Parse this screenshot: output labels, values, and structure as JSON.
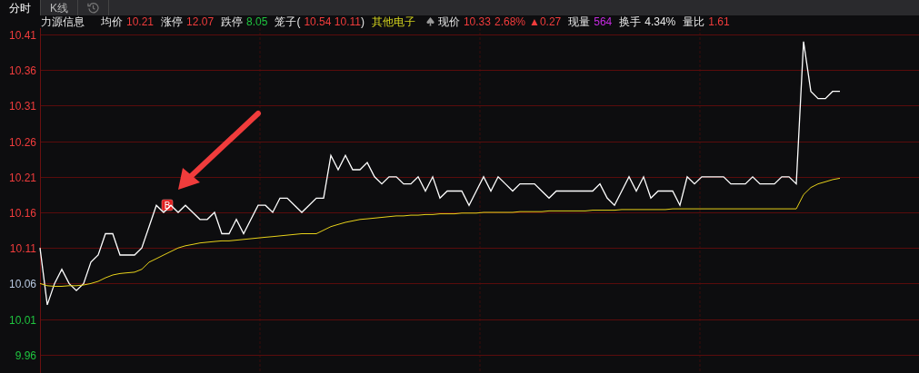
{
  "tabs": [
    {
      "kind": "text",
      "label": "分时",
      "selected": true
    },
    {
      "kind": "text",
      "label": "K线",
      "selected": false
    },
    {
      "kind": "history",
      "selected": false
    }
  ],
  "quote": [
    {
      "kind": "name",
      "text": "力源信息"
    },
    {
      "kind": "field",
      "label": "均价",
      "values": [
        {
          "text": "10.21",
          "color": "#f03c3c"
        }
      ]
    },
    {
      "kind": "field",
      "label": "涨停",
      "values": [
        {
          "text": "12.07",
          "color": "#f03c3c"
        }
      ]
    },
    {
      "kind": "field",
      "label": "跌停",
      "values": [
        {
          "text": "8.05",
          "color": "#1fc43f"
        }
      ]
    },
    {
      "kind": "field",
      "label": "笼子(",
      "values": [
        {
          "text": "10.54 10.11",
          "color": "#f03c3c"
        }
      ],
      "suffix": ")"
    },
    {
      "kind": "sector",
      "text": "其他电子"
    },
    {
      "kind": "price",
      "label": "现价",
      "values": [
        {
          "text": "10.33",
          "color": "#f03c3c"
        },
        {
          "text": "2.68%",
          "color": "#f03c3c"
        },
        {
          "text": "▲0.27",
          "color": "#f03c3c"
        }
      ]
    },
    {
      "kind": "field",
      "label": "现量",
      "values": [
        {
          "text": "564",
          "color": "#c42ae0"
        }
      ]
    },
    {
      "kind": "field",
      "label": "换手",
      "values": [
        {
          "text": "4.34%",
          "color": "#e8e8e8"
        }
      ]
    },
    {
      "kind": "field",
      "label": "量比",
      "values": [
        {
          "text": "1.61",
          "color": "#f03c3c"
        }
      ]
    }
  ],
  "chart_data": {
    "type": "line",
    "ylim": [
      9.96,
      10.41
    ],
    "grid": true,
    "yticks": [
      {
        "value": 10.41,
        "label": "10.41"
      },
      {
        "value": 10.36,
        "label": "10.36"
      },
      {
        "value": 10.31,
        "label": "10.31"
      },
      {
        "value": 10.26,
        "label": "10.26"
      },
      {
        "value": 10.21,
        "label": "10.21"
      },
      {
        "value": 10.16,
        "label": "10.16"
      },
      {
        "value": 10.11,
        "label": "10.11"
      },
      {
        "value": 10.06,
        "label": "10.06"
      },
      {
        "value": 10.01,
        "label": "10.01"
      },
      {
        "value": 9.96,
        "label": "9.96"
      }
    ],
    "series": [
      {
        "color": "#ffffff",
        "values": [
          10.11,
          10.03,
          10.06,
          10.08,
          10.06,
          10.05,
          10.06,
          10.09,
          10.1,
          10.13,
          10.13,
          10.1,
          10.1,
          10.1,
          10.11,
          10.14,
          10.17,
          10.16,
          10.17,
          10.16,
          10.17,
          10.16,
          10.15,
          10.15,
          10.16,
          10.13,
          10.13,
          10.15,
          10.13,
          10.15,
          10.17,
          10.17,
          10.16,
          10.18,
          10.18,
          10.17,
          10.16,
          10.17,
          10.18,
          10.18,
          10.24,
          10.22,
          10.24,
          10.22,
          10.22,
          10.23,
          10.21,
          10.2,
          10.21,
          10.21,
          10.2,
          10.2,
          10.21,
          10.19,
          10.21,
          10.18,
          10.19,
          10.19,
          10.19,
          10.17,
          10.19,
          10.21,
          10.19,
          10.21,
          10.2,
          10.19,
          10.2,
          10.2,
          10.2,
          10.19,
          10.18,
          10.19,
          10.19,
          10.19,
          10.19,
          10.19,
          10.19,
          10.2,
          10.18,
          10.17,
          10.19,
          10.21,
          10.19,
          10.21,
          10.18,
          10.19,
          10.19,
          10.19,
          10.17,
          10.21,
          10.2,
          10.21,
          10.21,
          10.21,
          10.21,
          10.2,
          10.2,
          10.2,
          10.21,
          10.2,
          10.2,
          10.2,
          10.21,
          10.21,
          10.2,
          10.4,
          10.33,
          10.32,
          10.32,
          10.33,
          10.33
        ]
      },
      {
        "color": "#e8d21a",
        "values": [
          10.06,
          10.057,
          10.056,
          10.056,
          10.057,
          10.057,
          10.058,
          10.06,
          10.063,
          10.068,
          10.072,
          10.074,
          10.075,
          10.076,
          10.08,
          10.09,
          10.095,
          10.1,
          10.105,
          10.11,
          10.113,
          10.115,
          10.117,
          10.118,
          10.119,
          10.12,
          10.12,
          10.121,
          10.122,
          10.123,
          10.124,
          10.125,
          10.126,
          10.127,
          10.128,
          10.129,
          10.13,
          10.13,
          10.13,
          10.135,
          10.14,
          10.143,
          10.146,
          10.148,
          10.15,
          10.151,
          10.152,
          10.153,
          10.154,
          10.155,
          10.155,
          10.156,
          10.156,
          10.157,
          10.157,
          10.158,
          10.158,
          10.158,
          10.159,
          10.159,
          10.159,
          10.16,
          10.16,
          10.16,
          10.16,
          10.16,
          10.161,
          10.161,
          10.161,
          10.161,
          10.162,
          10.162,
          10.162,
          10.162,
          10.162,
          10.162,
          10.163,
          10.163,
          10.163,
          10.163,
          10.164,
          10.164,
          10.164,
          10.164,
          10.164,
          10.164,
          10.164,
          10.165,
          10.165,
          10.165,
          10.165,
          10.165,
          10.165,
          10.165,
          10.165,
          10.165,
          10.165,
          10.165,
          10.165,
          10.165,
          10.165,
          10.165,
          10.165,
          10.165,
          10.165,
          10.185,
          10.195,
          10.2,
          10.203,
          10.206,
          10.208
        ]
      }
    ],
    "annotations": [
      {
        "text": "B",
        "y": 10.16
      }
    ]
  },
  "axis_labels": [
    {
      "color": "#f03c3c"
    },
    {
      "color": "#f03c3c"
    },
    {
      "color": "#f03c3c"
    },
    {
      "color": "#f03c3c"
    },
    {
      "color": "#f03c3c"
    },
    {
      "color": "#f03c3c"
    },
    {
      "color": "#f03c3c"
    },
    {
      "color": "#b8c8e0"
    },
    {
      "color": "#1fc43f"
    },
    {
      "color": "#1fc43f"
    }
  ]
}
